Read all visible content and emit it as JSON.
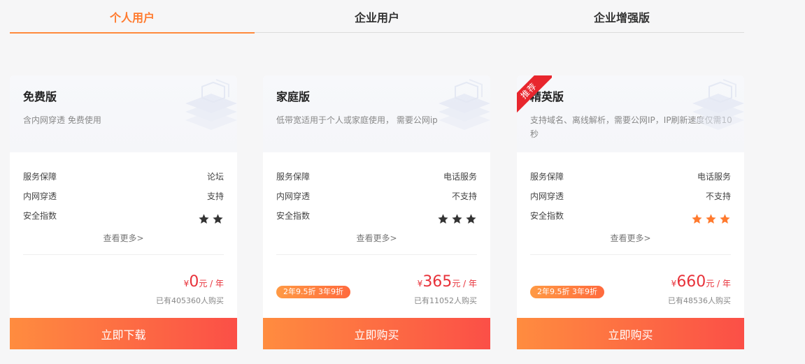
{
  "tabs": [
    {
      "label": "个人用户"
    },
    {
      "label": "企业用户"
    },
    {
      "label": "企业增强版"
    }
  ],
  "colors": {
    "accent": "#ff7a2e",
    "price": "#e8323a",
    "star_dark": "#333333",
    "star_orange": "#ff7a2e",
    "ribbon": "#e8262d"
  },
  "cards": [
    {
      "title": "免费版",
      "desc": "含内网穿透 免费使用",
      "ribbon": "",
      "rows": [
        {
          "label": "服务保障",
          "value": "论坛"
        },
        {
          "label": "内网穿透",
          "value": "支持"
        },
        {
          "label": "安全指数",
          "stars": 2,
          "star_color": "dark"
        }
      ],
      "more": "查看更多>",
      "promo": "",
      "price": {
        "currency": "¥",
        "amount": "0",
        "unit": "元 / 年"
      },
      "buyers": "已有405360人购买",
      "cta": "立即下载"
    },
    {
      "title": "家庭版",
      "desc": "低带宽适用于个人或家庭使用， 需要公网ip",
      "ribbon": "",
      "rows": [
        {
          "label": "服务保障",
          "value": "电话服务"
        },
        {
          "label": "内网穿透",
          "value": "不支持"
        },
        {
          "label": "安全指数",
          "stars": 3,
          "star_color": "dark"
        }
      ],
      "more": "查看更多>",
      "promo": "2年9.5折 3年9折",
      "price": {
        "currency": "¥",
        "amount": "365",
        "unit": "元 / 年"
      },
      "buyers": "已有11052人购买",
      "cta": "立即购买"
    },
    {
      "title": "精英版",
      "desc": "支持域名、离线解析，需要公网IP，IP刷新速度仅需10秒",
      "ribbon": "推荐",
      "rows": [
        {
          "label": "服务保障",
          "value": "电话服务"
        },
        {
          "label": "内网穿透",
          "value": "不支持"
        },
        {
          "label": "安全指数",
          "stars": 3,
          "star_color": "orange"
        }
      ],
      "more": "查看更多>",
      "promo": "2年9.5折 3年9折",
      "price": {
        "currency": "¥",
        "amount": "660",
        "unit": "元 / 年"
      },
      "buyers": "已有48536人购买",
      "cta": "立即购买"
    }
  ]
}
